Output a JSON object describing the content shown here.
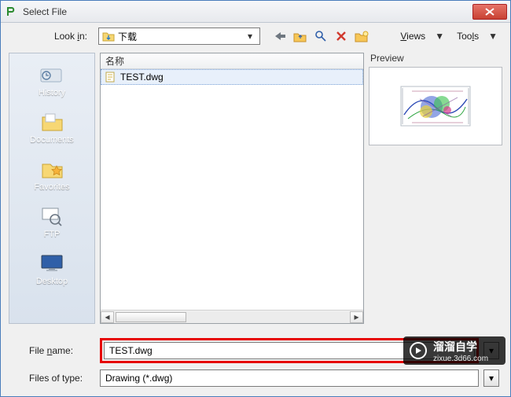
{
  "window": {
    "title": "Select File"
  },
  "toolbar": {
    "lookin_label": "Look in:",
    "lookin_value": "下载",
    "views_label": "Views",
    "tools_label": "Tools"
  },
  "toolbar_icons": {
    "back": "back-arrow",
    "up": "up-one-level",
    "search": "search",
    "delete": "delete",
    "new_folder": "new-folder"
  },
  "places": [
    {
      "id": "history",
      "label": "History"
    },
    {
      "id": "documents",
      "label": "Documents"
    },
    {
      "id": "favorites",
      "label": "Favorites"
    },
    {
      "id": "ftp",
      "label": "FTP"
    },
    {
      "id": "desktop",
      "label": "Desktop"
    }
  ],
  "filelist": {
    "header": "名称",
    "items": [
      {
        "name": "TEST.dwg",
        "selected": true
      }
    ]
  },
  "preview": {
    "label": "Preview"
  },
  "bottom": {
    "filename_label": "File name:",
    "filename_value": "TEST.dwg",
    "filetype_label": "Files of type:",
    "filetype_value": "Drawing (*.dwg)"
  },
  "watermark": {
    "title": "溜溜自学",
    "url": "zixue.3d66.com"
  }
}
